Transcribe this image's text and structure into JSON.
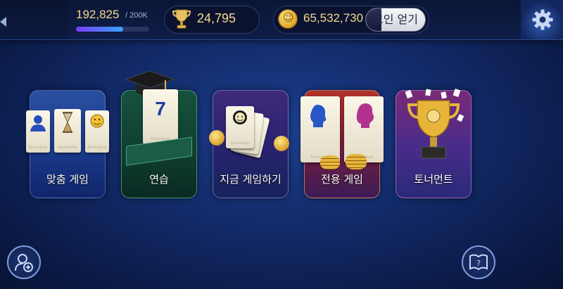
{
  "top_bar": {
    "level_value": "192,825",
    "level_max": "/ 200K",
    "level_progress": 0.64,
    "trophy_value": "24,795",
    "coin_value": "65,532,730",
    "get_coins_label": "코인 얻기"
  },
  "modes": [
    {
      "label": "맞춤 게임"
    },
    {
      "label": "연습"
    },
    {
      "label": "지금 게임하기"
    },
    {
      "label": "전용 게임"
    },
    {
      "label": "토너먼트"
    }
  ],
  "practice_tile_number": "7",
  "tile_brand": "Rummikub",
  "colors": {
    "accent_gold": "#f6d98a",
    "background": "#122a68",
    "progress_start": "#7b3cff",
    "progress_end": "#36a6ff"
  },
  "icons": {
    "back": "back-arrow-icon",
    "trophy": "trophy-icon",
    "coin": "coin-icon",
    "settings": "gear-icon",
    "add_friend": "add-friend-icon",
    "help": "help-book-icon"
  }
}
